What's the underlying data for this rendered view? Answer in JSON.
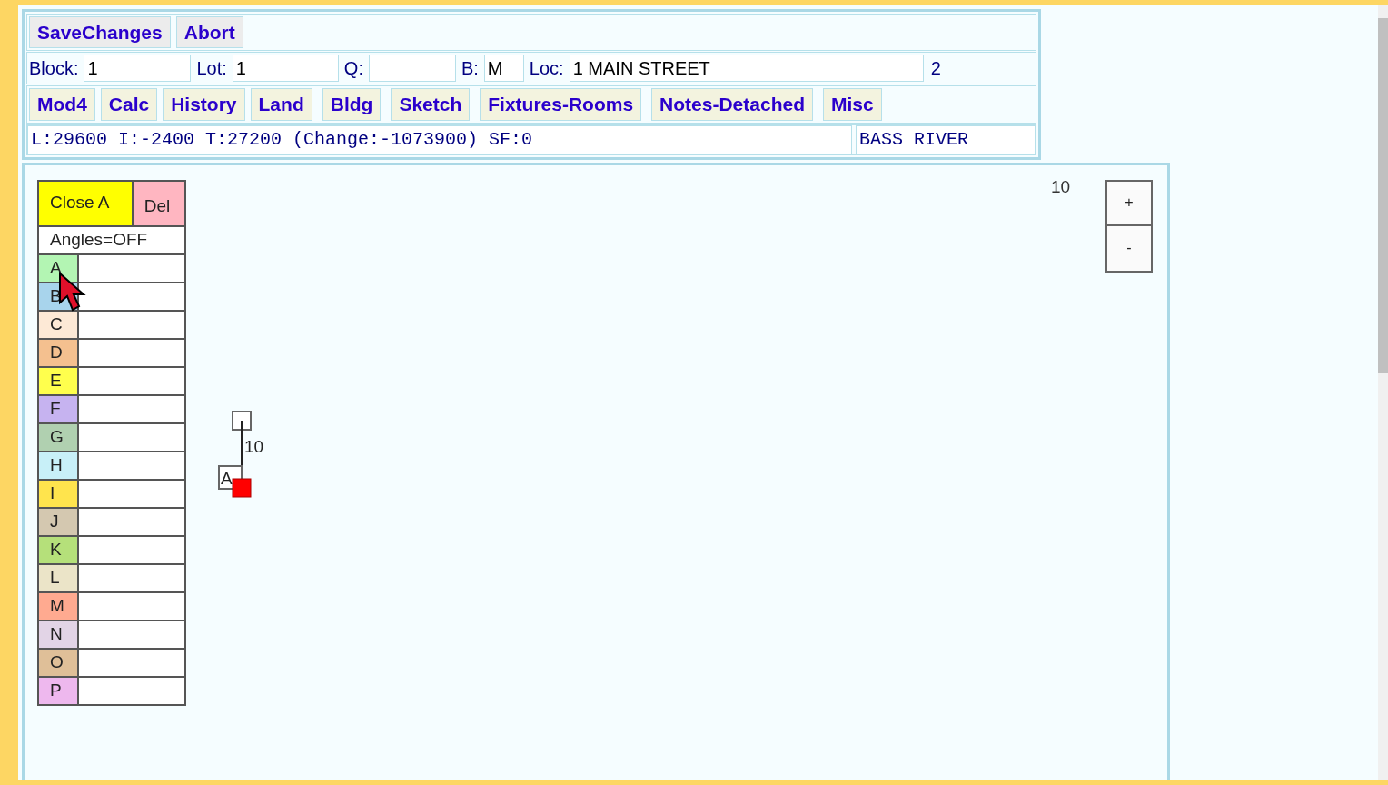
{
  "toolbar": {
    "buttons": [
      "SaveChanges",
      "Abort"
    ]
  },
  "fields": [
    {
      "label": "Block:",
      "value": "1"
    },
    {
      "label": "Lot:",
      "value": "1"
    },
    {
      "label": "Q:"
    },
    {
      "label": "B:",
      "value": "M"
    },
    {
      "label": "Loc:",
      "value": "1 MAIN STREET"
    }
  ],
  "field_note": "2",
  "nav_buttons": [
    "Mod4",
    "Calc",
    "History",
    "Land",
    "Bldg",
    "Sketch",
    "Fixtures-Rooms",
    "Notes-Detached",
    "Misc"
  ],
  "summary": "L:29600 I:-2400 T:27200 (Change:-1073900) SF:0",
  "town": "BASS RIVER",
  "sketch": {
    "close_button": "Close A",
    "delete_button": "Del",
    "angles_toggle": "Angles=OFF",
    "sections": [
      {
        "letter": "A",
        "color": "#b3f5b3"
      },
      {
        "letter": "B",
        "color": "#a8d4ec"
      },
      {
        "letter": "C",
        "color": "#fde9d6"
      },
      {
        "letter": "D",
        "color": "#f4c08f"
      },
      {
        "letter": "E",
        "color": "#ffff4d"
      },
      {
        "letter": "F",
        "color": "#c6b3f0"
      },
      {
        "letter": "G",
        "color": "#b0d0b0"
      },
      {
        "letter": "H",
        "color": "#c8f0f8"
      },
      {
        "letter": "I",
        "color": "#ffe44d"
      },
      {
        "letter": "J",
        "color": "#d4c8b0"
      },
      {
        "letter": "K",
        "color": "#b5e07a"
      },
      {
        "letter": "L",
        "color": "#ebe4c8"
      },
      {
        "letter": "M",
        "color": "#ffaa90"
      },
      {
        "letter": "N",
        "color": "#e2d4e6"
      },
      {
        "letter": "O",
        "color": "#dfbf98"
      },
      {
        "letter": "P",
        "color": "#eeb8ee"
      }
    ],
    "scale_label": "10",
    "zoom_in": "+",
    "zoom_out": "-",
    "shape": {
      "label": "A",
      "dimension": "10"
    }
  }
}
